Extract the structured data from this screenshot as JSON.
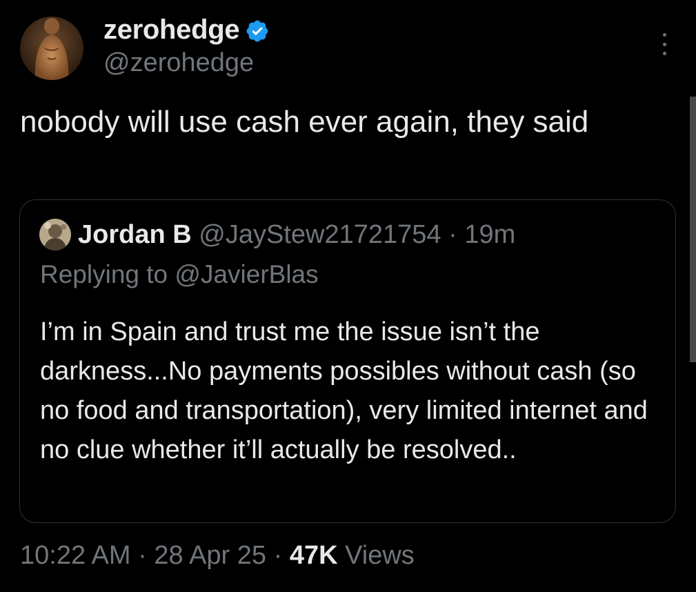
{
  "author": {
    "display_name": "zerohedge",
    "handle": "@zerohedge",
    "verified": true,
    "verified_color": "#1d9bf0"
  },
  "tweet": {
    "text": "nobody will use cash ever again, they said"
  },
  "quoted": {
    "display_name": "Jordan B",
    "handle": "@JayStew21721754",
    "separator": "·",
    "time_ago": "19m",
    "replying_to": "Replying to @JavierBlas",
    "text": "I’m in Spain and trust me the issue isn’t the darkness...No payments possibles without cash (so no food and transportation), very limited internet and no clue whether it’ll actually be resolved.."
  },
  "footer": {
    "time": "10:22 AM",
    "separator": "·",
    "date": "28 Apr 25",
    "separator2": "·",
    "views_count": "47K",
    "views_label": "Views"
  },
  "icons": {
    "verified": "verified-badge-icon",
    "more": "more-options-icon"
  },
  "colors": {
    "background": "#000000",
    "text_primary": "#e7e9ea",
    "text_secondary": "#71767b",
    "border": "#2f3336"
  }
}
